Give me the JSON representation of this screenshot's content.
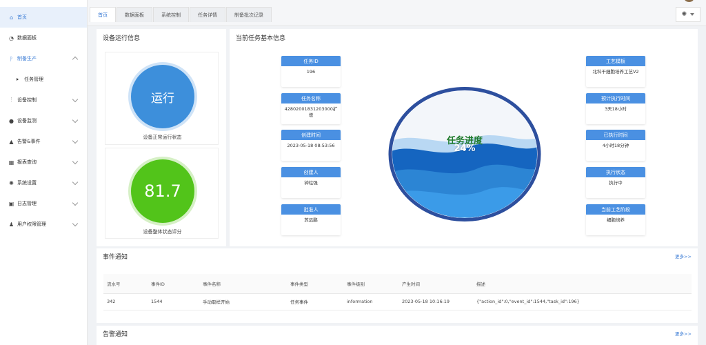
{
  "sidebar": {
    "items": [
      {
        "label": "首页",
        "icon": "home-icon"
      },
      {
        "label": "数据面板",
        "icon": "dashboard-icon"
      },
      {
        "label": "制备生产",
        "icon": "production-icon",
        "sub": "任务管理"
      },
      {
        "label": "设备控制",
        "icon": "device-control-icon"
      },
      {
        "label": "设备监测",
        "icon": "location-icon"
      },
      {
        "label": "告警&事件",
        "icon": "alarm-icon"
      },
      {
        "label": "报表查询",
        "icon": "report-icon"
      },
      {
        "label": "系统设置",
        "icon": "gear-icon"
      },
      {
        "label": "日志管理",
        "icon": "log-icon"
      },
      {
        "label": "用户权限管理",
        "icon": "user-icon"
      }
    ]
  },
  "tabs": [
    "首页",
    "数据面板",
    "系统控制",
    "任务详情",
    "制备批次记录"
  ],
  "device": {
    "title": "设备运行信息",
    "status_value": "运行",
    "status_caption": "设备正常运行状态",
    "score_value": "81.7",
    "score_caption": "设备整体状态评分"
  },
  "task": {
    "title": "当前任务基本信息",
    "left": [
      {
        "label": "任务ID",
        "value": "196"
      },
      {
        "label": "任务名称",
        "value": "42802001831203000扩增"
      },
      {
        "label": "创建时间",
        "value": "2023-05-18 08:53:56"
      },
      {
        "label": "创建人",
        "value": "钟柱强"
      },
      {
        "label": "批准人",
        "value": "苏远鹏"
      }
    ],
    "right": [
      {
        "label": "工艺模板",
        "value": "北科干细胞培养工艺V2"
      },
      {
        "label": "预计执行时间",
        "value": "3天18小时"
      },
      {
        "label": "已执行时间",
        "value": "4小时18分钟"
      },
      {
        "label": "执行状态",
        "value": "执行中"
      },
      {
        "label": "当前工艺阶段",
        "value": "细胞培养"
      }
    ],
    "progress_label": "任务进度",
    "progress_text": "24%",
    "progress_value": 0.24
  },
  "events": {
    "title": "事件通知",
    "more": "更多>>",
    "columns": [
      "流水号",
      "事件ID",
      "事件名称",
      "事件类型",
      "事件级别",
      "产生时间",
      "描述"
    ],
    "rows": [
      [
        "342",
        "1544",
        "手动取样开始",
        "任务事件",
        "information",
        "2023-05-18 10:16:19",
        "{\"action_id\":0,\"event_id\":1544,\"task_id\":196}"
      ]
    ]
  },
  "alarms": {
    "title": "告警通知",
    "more": "更多>>"
  },
  "colors": {
    "accent": "#3a7bd5",
    "status_blue": "#3d8fdb",
    "score_green": "#52c41a",
    "wave_dark": "#1565c0",
    "gauge_ring": "#2d4f9e"
  }
}
